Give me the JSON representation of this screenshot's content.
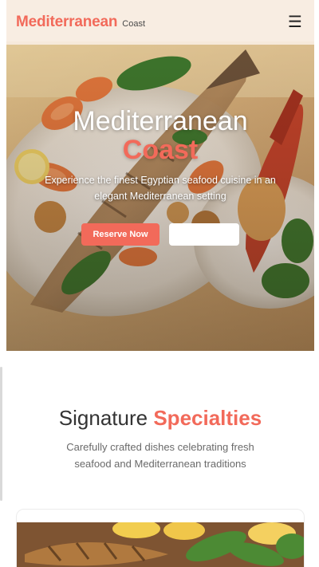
{
  "header": {
    "brand_main": "Mediterranean",
    "brand_sub": "Coast",
    "menu_icon": "hamburger-menu-icon"
  },
  "hero": {
    "title_line1": "Mediterranean",
    "title_line2": "Coast",
    "subtitle": "Experience the finest Egyptian seafood cuisine in an elegant Mediterranean setting",
    "primary_button": "Reserve Now",
    "secondary_button": ""
  },
  "specialties": {
    "title_plain": "Signature",
    "title_accent": "Specialties",
    "subtitle": "Carefully crafted dishes celebrating fresh seafood and Mediterranean traditions"
  },
  "colors": {
    "accent": "#f26a5a",
    "header_bg": "#f7ece0",
    "text_dark": "#333333",
    "text_muted": "#6a6a6a"
  }
}
